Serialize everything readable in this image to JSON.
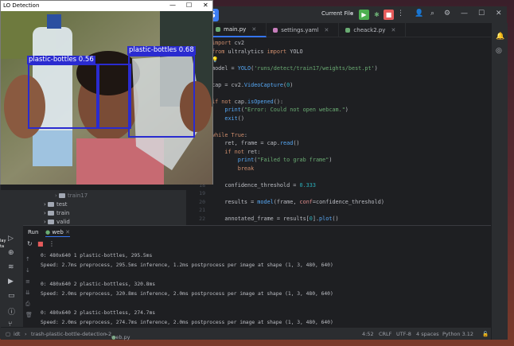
{
  "ide": {
    "run_config": "Current File",
    "tabs": [
      {
        "label": "main.py",
        "icon": "python-file-icon"
      },
      {
        "label": "settings.yaml",
        "icon": "yaml-file-icon"
      },
      {
        "label": "cheack2.py",
        "icon": "python-file-icon"
      }
    ],
    "code_lines": [
      {
        "n": "1",
        "html": "<span class='kw'>import</span><span class='plain'> cv2</span>"
      },
      {
        "n": "2",
        "html": "<span class='kw'>from</span><span class='plain'> ultralytics </span><span class='kw'>import</span><span class='plain'> YOLO</span>"
      },
      {
        "n": "3",
        "html": "<span class='bulb'>💡</span>"
      },
      {
        "n": "4",
        "html": "<span class='plain'>model = </span><span class='fn'>YOLO</span><span class='plain'>(</span><span class='str'>'runs/detect/train17/weights/best.pt'</span><span class='plain'>)</span>"
      },
      {
        "n": "5",
        "html": ""
      },
      {
        "n": "6",
        "html": "<span class='plain'>cap = cv2.</span><span class='fn'>VideoCapture</span><span class='plain'>(</span><span class='num'>0</span><span class='plain'>)</span>"
      },
      {
        "n": "7",
        "html": ""
      },
      {
        "n": "8",
        "html": "<span class='kw'>if not</span><span class='plain'> cap.</span><span class='fn'>isOpened</span><span class='plain'>():</span>"
      },
      {
        "n": "9",
        "html": "<span class='plain'>    </span><span class='fn'>print</span><span class='plain'>(</span><span class='str'>\"Error: Could not open webcam.\"</span><span class='plain'>)</span>"
      },
      {
        "n": "10",
        "html": "<span class='plain'>    </span><span class='fn'>exit</span><span class='plain'>()</span>"
      },
      {
        "n": "11",
        "html": ""
      },
      {
        "n": "12",
        "html": "<span class='kw'>while True</span><span class='plain'>:</span>"
      },
      {
        "n": "13",
        "html": "<span class='plain'>    ret, frame = cap.</span><span class='fn'>read</span><span class='plain'>()</span>"
      },
      {
        "n": "14",
        "html": "<span class='plain'>    </span><span class='kw'>if not</span><span class='plain'> ret:</span>"
      },
      {
        "n": "15",
        "html": "<span class='plain'>        </span><span class='fn'>print</span><span class='plain'>(</span><span class='str'>\"Failed to grab frame\"</span><span class='plain'>)</span>"
      },
      {
        "n": "16",
        "html": "<span class='plain'>        </span><span class='kw'>break</span>"
      },
      {
        "n": "17",
        "html": ""
      },
      {
        "n": "18",
        "html": "<span class='plain'>    confidence_threshold = </span><span class='num'>0.333</span>"
      },
      {
        "n": "19",
        "html": ""
      },
      {
        "n": "20",
        "html": "<span class='plain'>    results = </span><span class='fn'>model</span><span class='plain'>(frame, </span><span class='param'>conf</span><span class='plain'>=confidence_threshold)</span>"
      },
      {
        "n": "21",
        "html": ""
      },
      {
        "n": "22",
        "html": "<span class='plain'>    annotated_frame = results[</span><span class='num'>0</span><span class='plain'>].</span><span class='fn'>plot</span><span class='plain'>()</span>"
      }
    ],
    "tree": {
      "partial_top": "train17",
      "items": [
        "test",
        "train",
        "valid"
      ]
    },
    "run": {
      "label": "Run",
      "tab": "web",
      "output": [
        "0: 480x640 1 plastic-bottles, 295.5ms",
        "Speed: 2.7ms preprocess, 295.5ms inference, 1.2ms postprocess per image at shape (1, 3, 480, 640)",
        "",
        "0: 480x640 2 plastic-bottless, 320.8ms",
        "Speed: 2.0ms preprocess, 320.8ms inference, 2.0ms postprocess per image at shape (1, 3, 480, 640)",
        "",
        "0: 480x640 2 plastic-bottless, 274.7ms",
        "Speed: 2.0ms preprocess, 274.7ms inference, 2.0ms postprocess per image at shape (1, 3, 480, 640)"
      ]
    },
    "status": {
      "path_root": "idt",
      "project": "trash-plastic-bottle-detection-2",
      "file": "web.py",
      "position": "4:52",
      "line_ending": "CRLF",
      "encoding": "UTF-8",
      "indent": "4 spaces",
      "interpreter": "Python 3.12"
    },
    "desktop_sliver": "lay ta"
  },
  "yolo_window": {
    "title": "LO Detection",
    "detections": [
      {
        "label": "plastic-bottles  0.56"
      },
      {
        "label": "plastic-bottles  0.68"
      }
    ]
  },
  "colors": {
    "accent": "#3574f0",
    "box": "#2a2bd0",
    "run_green": "#4caf50",
    "stop_red": "#e55b5b"
  }
}
